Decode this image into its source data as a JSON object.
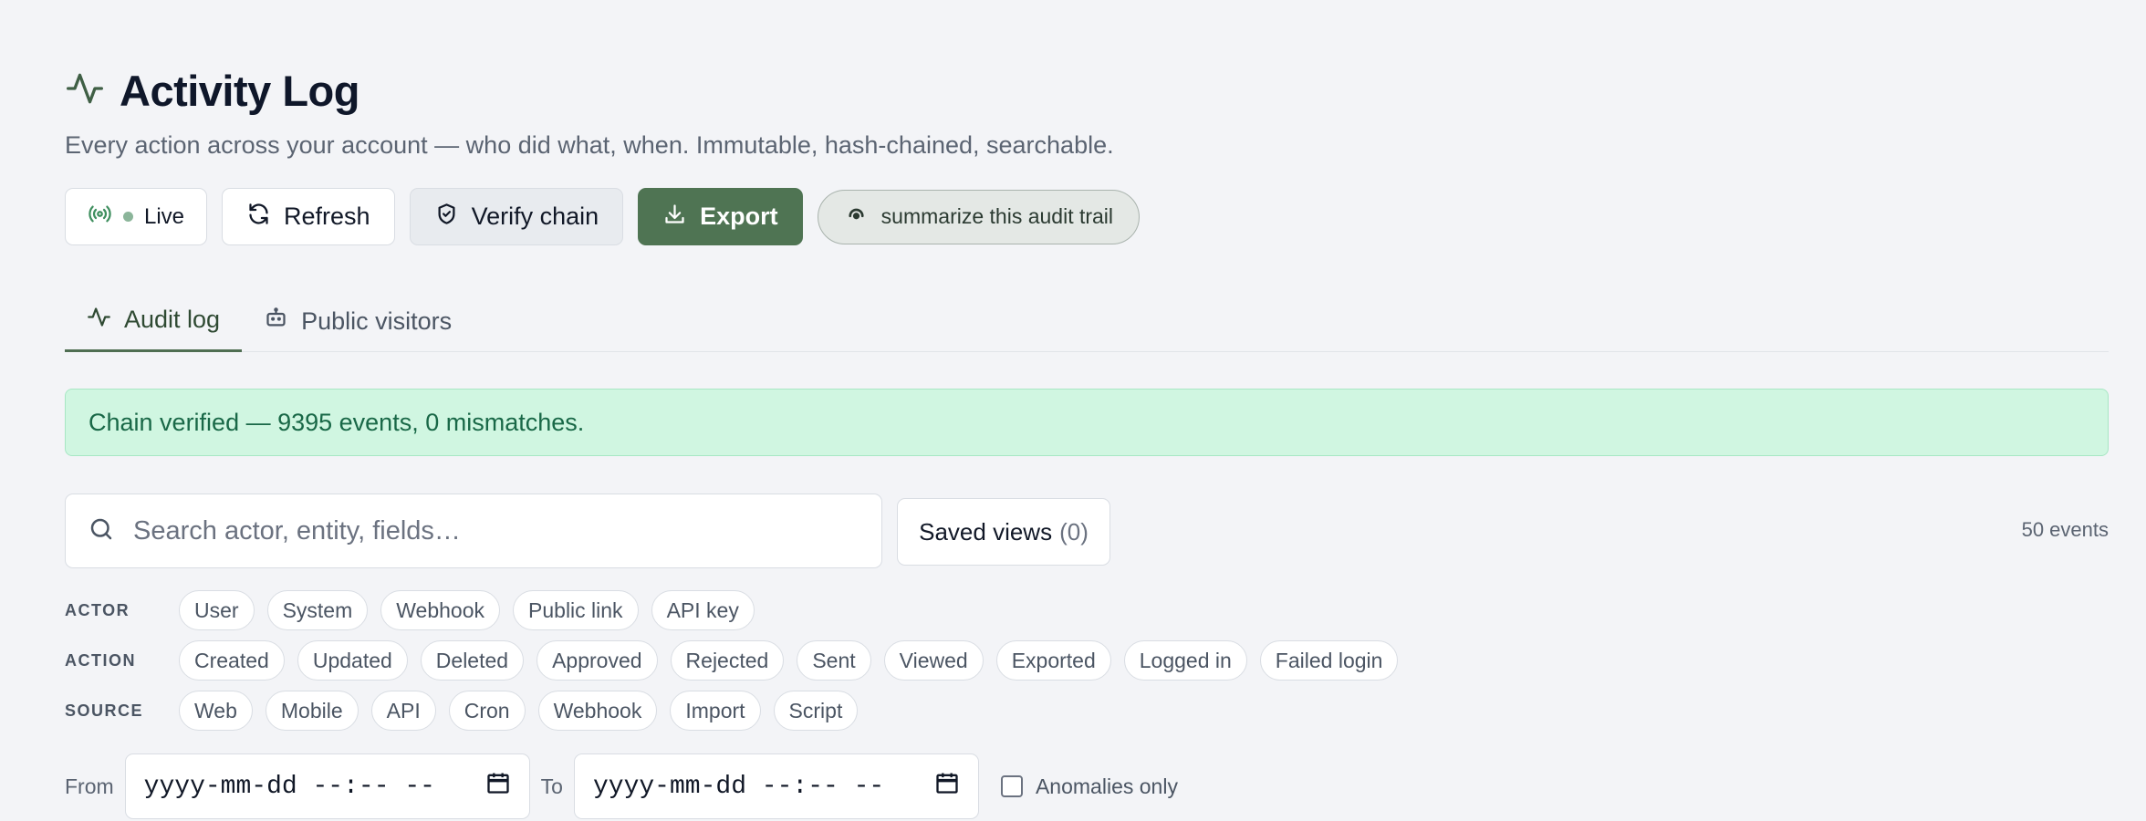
{
  "header": {
    "title": "Activity Log",
    "subtitle": "Every action across your account — who did what, when. Immutable, hash-chained, searchable.",
    "icon": "activity-icon"
  },
  "toolbar": {
    "live_label": "Live",
    "refresh_label": "Refresh",
    "verify_label": "Verify chain",
    "export_label": "Export",
    "summarize_label": "summarize this audit trail"
  },
  "tabs": [
    {
      "label": "Audit log",
      "icon": "activity-icon",
      "active": true
    },
    {
      "label": "Public visitors",
      "icon": "robot-icon",
      "active": false
    }
  ],
  "banner": {
    "text": "Chain verified — 9395 events, 0 mismatches."
  },
  "search": {
    "placeholder": "Search actor, entity, fields…"
  },
  "saved_views": {
    "label": "Saved views",
    "count": "(0)"
  },
  "events_count": "50 events",
  "filters": {
    "actor": {
      "label": "ACTOR",
      "chips": [
        "User",
        "System",
        "Webhook",
        "Public link",
        "API key"
      ]
    },
    "action": {
      "label": "ACTION",
      "chips": [
        "Created",
        "Updated",
        "Deleted",
        "Approved",
        "Rejected",
        "Sent",
        "Viewed",
        "Exported",
        "Logged in",
        "Failed login"
      ]
    },
    "source": {
      "label": "SOURCE",
      "chips": [
        "Web",
        "Mobile",
        "API",
        "Cron",
        "Webhook",
        "Import",
        "Script"
      ]
    }
  },
  "dates": {
    "from_label": "From",
    "from_value": "yyyy-mm-dd --:-- --",
    "to_label": "To",
    "to_value": "yyyy-mm-dd --:-- --"
  },
  "anomalies": {
    "label": "Anomalies only",
    "checked": false
  },
  "colors": {
    "accent": "#4f7453",
    "banner_bg": "#d0f6e1",
    "banner_text": "#196847",
    "background": "#f3f4f7"
  }
}
